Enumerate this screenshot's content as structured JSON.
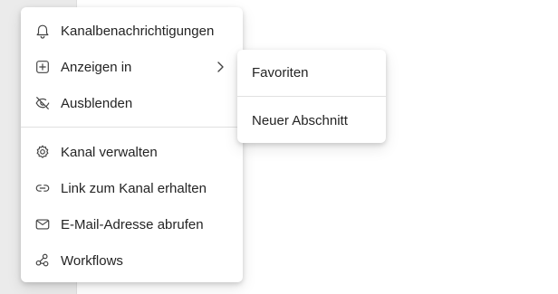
{
  "context_menu": {
    "items": [
      {
        "label": "Kanalbenachrichtigungen",
        "icon": "bell-icon"
      },
      {
        "label": "Anzeigen in",
        "icon": "add-square-icon",
        "has_submenu": true
      },
      {
        "label": "Ausblenden",
        "icon": "eye-off-icon"
      },
      {
        "label": "Kanal verwalten",
        "icon": "gear-icon"
      },
      {
        "label": "Link zum Kanal erhalten",
        "icon": "link-icon"
      },
      {
        "label": "E-Mail-Adresse abrufen",
        "icon": "mail-icon"
      },
      {
        "label": "Workflows",
        "icon": "workflows-icon"
      }
    ]
  },
  "submenu": {
    "items": [
      {
        "label": "Favoriten"
      },
      {
        "label": "Neuer Abschnitt"
      }
    ]
  }
}
